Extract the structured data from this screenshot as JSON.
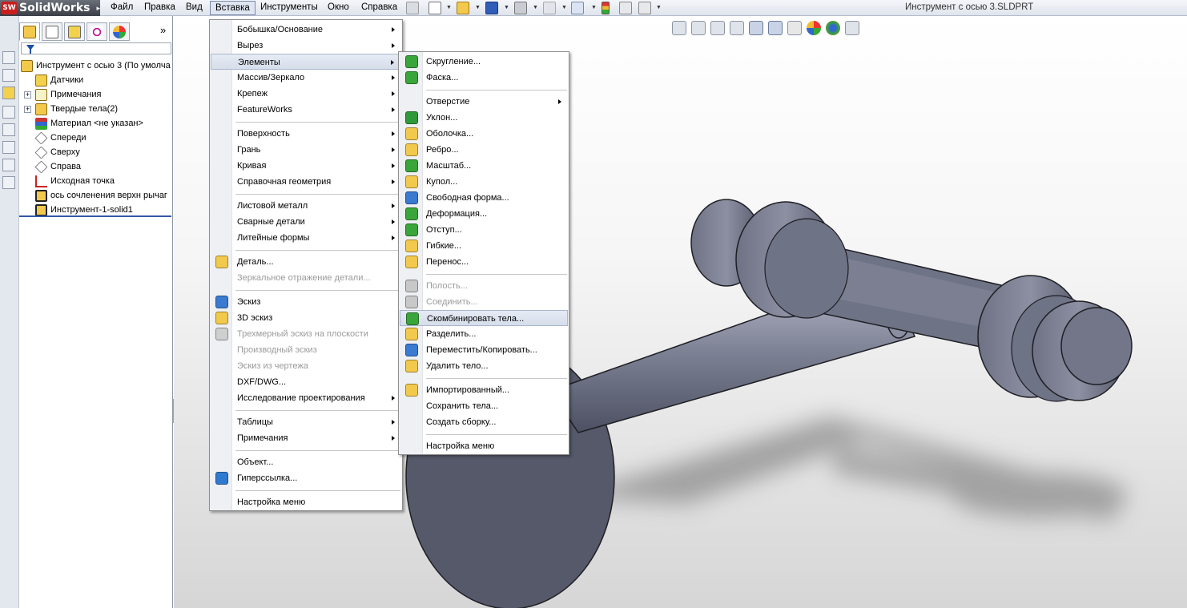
{
  "app": {
    "logo_badge": "SW",
    "logo_name": "SolidWorks",
    "doc_title": "Инструмент с осью 3.SLDPRT"
  },
  "menubar": [
    "Файл",
    "Правка",
    "Вид",
    "Вставка",
    "Инструменты",
    "Окно",
    "Справка"
  ],
  "menubar_active": "Вставка",
  "tree": {
    "root": "Инструмент с осью 3  (По умолча",
    "items": [
      {
        "label": "Датчики",
        "icon": "sensors-icon",
        "expander": false
      },
      {
        "label": "Примечания",
        "icon": "annotations-icon",
        "expander": true
      },
      {
        "label": "Твердые тела(2)",
        "icon": "solid-bodies-icon",
        "expander": true
      },
      {
        "label": "Материал <не указан>",
        "icon": "material-icon",
        "expander": false
      },
      {
        "label": "Спереди",
        "icon": "plane-icon",
        "expander": false
      },
      {
        "label": "Сверху",
        "icon": "plane-icon",
        "expander": false
      },
      {
        "label": "Справа",
        "icon": "plane-icon",
        "expander": false
      },
      {
        "label": "Исходная точка",
        "icon": "origin-icon",
        "expander": false
      },
      {
        "label": "ось  сочленения верхн рычаг",
        "icon": "feature-icon",
        "expander": false
      },
      {
        "label": "Инструмент-1-solid1",
        "icon": "feature-icon",
        "expander": false
      }
    ]
  },
  "insert_menu": [
    {
      "label": "Бобышка/Основание",
      "submenu": true
    },
    {
      "label": "Вырез",
      "submenu": true
    },
    {
      "label": "Элементы",
      "submenu": true,
      "highlighted": true
    },
    {
      "label": "Массив/Зеркало",
      "submenu": true
    },
    {
      "label": "Крепеж",
      "submenu": true
    },
    {
      "label": "FeatureWorks",
      "submenu": true
    },
    {
      "separator": true
    },
    {
      "label": "Поверхность",
      "submenu": true
    },
    {
      "label": "Грань",
      "submenu": true
    },
    {
      "label": "Кривая",
      "submenu": true
    },
    {
      "label": "Справочная геометрия",
      "submenu": true
    },
    {
      "separator": true
    },
    {
      "label": "Листовой металл",
      "submenu": true
    },
    {
      "label": "Сварные детали",
      "submenu": true
    },
    {
      "label": "Литейные формы",
      "submenu": true
    },
    {
      "separator": true
    },
    {
      "label": "Деталь...",
      "icon": "part-icon"
    },
    {
      "label": "Зеркальное отражение детали...",
      "disabled": true
    },
    {
      "separator": true
    },
    {
      "label": "Эскиз",
      "icon": "sketch-icon"
    },
    {
      "label": "3D эскиз",
      "icon": "3d-sketch-icon"
    },
    {
      "label": "Трехмерный эскиз на плоскости",
      "icon": "3d-sketch-plane-icon",
      "disabled": true
    },
    {
      "label": "Производный эскиз",
      "disabled": true
    },
    {
      "label": "Эскиз из чертежа",
      "disabled": true
    },
    {
      "label": "DXF/DWG..."
    },
    {
      "label": "Исследование проектирования",
      "submenu": true
    },
    {
      "separator": true
    },
    {
      "label": "Таблицы",
      "submenu": true
    },
    {
      "label": "Примечания",
      "submenu": true
    },
    {
      "separator": true
    },
    {
      "label": "Объект..."
    },
    {
      "label": "Гиперссылка...",
      "icon": "hyperlink-icon"
    },
    {
      "separator": true
    },
    {
      "label": "Настройка меню"
    }
  ],
  "features_menu": [
    {
      "label": "Скругление...",
      "icon": "fillet-icon"
    },
    {
      "label": "Фаска...",
      "icon": "chamfer-icon"
    },
    {
      "separator": true
    },
    {
      "label": "Отверстие",
      "submenu": true
    },
    {
      "label": "Уклон...",
      "icon": "draft-icon"
    },
    {
      "label": "Оболочка...",
      "icon": "shell-icon"
    },
    {
      "label": "Ребро...",
      "icon": "rib-icon"
    },
    {
      "label": "Масштаб...",
      "icon": "scale-icon"
    },
    {
      "label": "Купол...",
      "icon": "dome-icon"
    },
    {
      "label": "Свободная форма...",
      "icon": "freeform-icon"
    },
    {
      "label": "Деформация...",
      "icon": "deform-icon"
    },
    {
      "label": "Отступ...",
      "icon": "indent-icon"
    },
    {
      "label": "Гибкие...",
      "icon": "flex-icon"
    },
    {
      "label": "Перенос...",
      "icon": "wrap-icon"
    },
    {
      "separator": true
    },
    {
      "label": "Полость...",
      "icon": "cavity-icon",
      "disabled": true
    },
    {
      "label": "Соединить...",
      "icon": "join-icon",
      "disabled": true
    },
    {
      "label": "Скомбинировать тела...",
      "icon": "combine-icon",
      "highlighted": true
    },
    {
      "label": "Разделить...",
      "icon": "split-icon"
    },
    {
      "label": "Переместить/Копировать...",
      "icon": "move-copy-icon"
    },
    {
      "label": "Удалить тело...",
      "icon": "delete-body-icon"
    },
    {
      "separator": true
    },
    {
      "label": "Импортированный...",
      "icon": "imported-icon"
    },
    {
      "label": "Сохранить тела..."
    },
    {
      "label": "Создать сборку..."
    },
    {
      "separator": true
    },
    {
      "label": "Настройка меню"
    }
  ],
  "colors": {
    "accent_blue": "#3358a8",
    "model_gray": "#6f7386",
    "menu_highlight": "#d6deeb"
  }
}
